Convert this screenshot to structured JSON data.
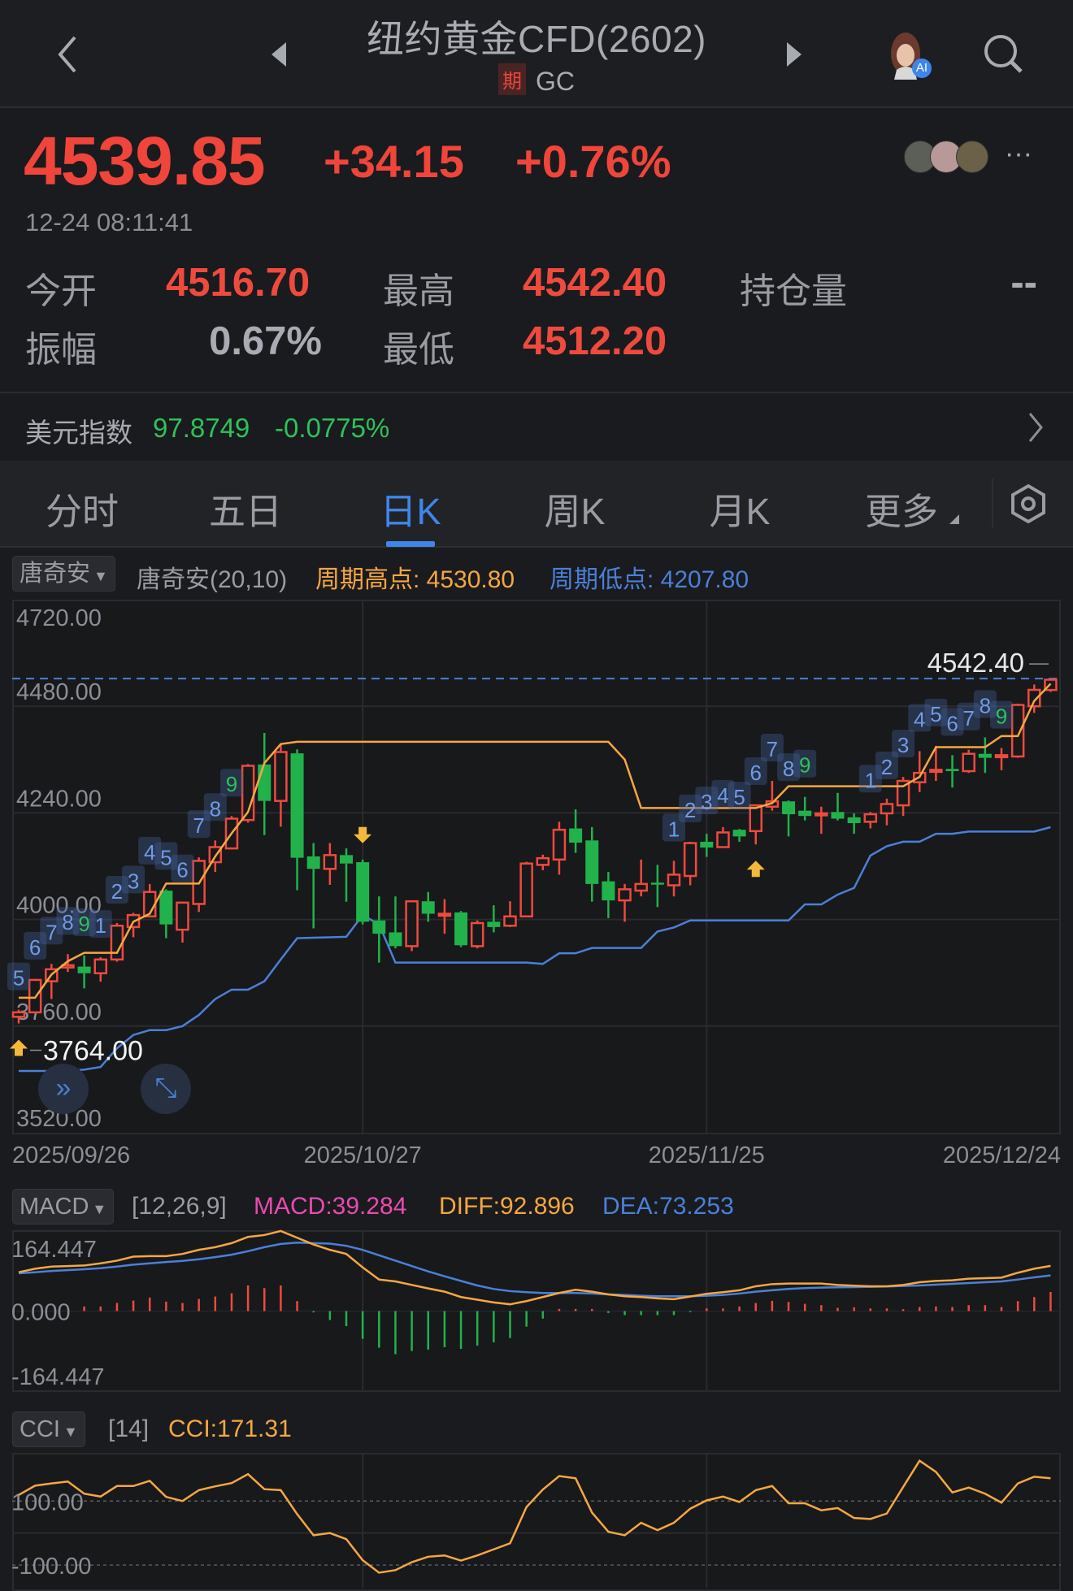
{
  "header": {
    "title": "纽约黄金CFD(2602)",
    "badge": "期",
    "code": "GC",
    "ai_badge": "AI",
    "icons": [
      "back-chevron-icon",
      "prev-triangle-icon",
      "next-triangle-icon",
      "ai-avatar-icon",
      "search-icon"
    ]
  },
  "quote": {
    "price": "4539.85",
    "change": "+34.15",
    "change_pct": "+0.76%",
    "timestamp": "12-24 08:11:41",
    "more": "···",
    "stats": {
      "open_label": "今开",
      "open": "4516.70",
      "high_label": "最高",
      "high": "4542.40",
      "oi_label": "持仓量",
      "oi": "--",
      "amp_label": "振幅",
      "amp": "0.67%",
      "low_label": "最低",
      "low": "4512.20"
    }
  },
  "usd_index": {
    "label": "美元指数",
    "value": "97.8749",
    "change": "-0.0775%"
  },
  "tabs": [
    {
      "label": "分时"
    },
    {
      "label": "五日"
    },
    {
      "label": "日K",
      "active": true
    },
    {
      "label": "周K"
    },
    {
      "label": "月K"
    },
    {
      "label": "更多"
    }
  ],
  "main_indicator": {
    "selector": "唐奇安",
    "params": "唐奇安(20,10)",
    "upper_text": "周期高点: 4530.80",
    "lower_text": "周期低点: 4207.80"
  },
  "macd_indicator": {
    "selector": "MACD",
    "params": "[12,26,9]",
    "macd": "MACD:39.284",
    "diff": "DIFF:92.896",
    "dea": "DEA:73.253"
  },
  "cci_indicator": {
    "selector": "CCI",
    "params": "[14]",
    "cci": "CCI:171.31"
  },
  "colors": {
    "up": "#ef4a3e",
    "down": "#22b24c",
    "upper": "#f5a742",
    "lower": "#4a80d8",
    "accent": "#3f86ea",
    "macd": "#e84bb0"
  },
  "chart_data": [
    {
      "type": "candlestick",
      "title": "日K",
      "ylim": [
        3520,
        4720
      ],
      "yticks": [
        "4720.00",
        "4480.00",
        "4240.00",
        "4000.00",
        "3760.00",
        "3520.00"
      ],
      "ytick_values": [
        4720,
        4480,
        4240,
        4000,
        3760,
        3520
      ],
      "x_labels": [
        {
          "label": "2025/09/26",
          "index": 0
        },
        {
          "label": "2025/10/27",
          "index": 21
        },
        {
          "label": "2025/11/25",
          "index": 42
        },
        {
          "label": "2025/12/24",
          "index": 63
        }
      ],
      "ohlc": [
        [
          3781,
          3797,
          3766,
          3791
        ],
        [
          3791,
          3866,
          3788,
          3864
        ],
        [
          3861,
          3900,
          3821,
          3888
        ],
        [
          3892,
          3922,
          3882,
          3897
        ],
        [
          3894,
          3919,
          3845,
          3879
        ],
        [
          3879,
          3915,
          3860,
          3910
        ],
        [
          3910,
          3992,
          3905,
          3986
        ],
        [
          3983,
          4015,
          3960,
          4010
        ],
        [
          4007,
          4080,
          4007,
          4062
        ],
        [
          4065,
          4068,
          3958,
          3989
        ],
        [
          3977,
          4040,
          3948,
          4038
        ],
        [
          4035,
          4140,
          4017,
          4132
        ],
        [
          4129,
          4178,
          4107,
          4163
        ],
        [
          4160,
          4233,
          4160,
          4227
        ],
        [
          4224,
          4350,
          4218,
          4346
        ],
        [
          4349,
          4420,
          4190,
          4267
        ],
        [
          4267,
          4395,
          4209,
          4377
        ],
        [
          4374,
          4383,
          4066,
          4139
        ],
        [
          4142,
          4172,
          3980,
          4114
        ],
        [
          4114,
          4172,
          4078,
          4145
        ],
        [
          4145,
          4160,
          4040,
          4126
        ],
        [
          4129,
          4135,
          3989,
          3995
        ],
        [
          3998,
          4052,
          3903,
          3968
        ],
        [
          3971,
          4052,
          3935,
          3940
        ],
        [
          3940,
          4043,
          3929,
          4041
        ],
        [
          4041,
          4062,
          3995,
          4013
        ],
        [
          4010,
          4046,
          3968,
          4013
        ],
        [
          4016,
          4019,
          3938,
          3942
        ],
        [
          3940,
          3998,
          3935,
          3992
        ],
        [
          3995,
          4032,
          3971,
          3983
        ],
        [
          3986,
          4041,
          3983,
          4007
        ],
        [
          4007,
          4130,
          4005,
          4126
        ],
        [
          4123,
          4146,
          4111,
          4138
        ],
        [
          4135,
          4220,
          4101,
          4202
        ],
        [
          4205,
          4248,
          4150,
          4173
        ],
        [
          4178,
          4208,
          4040,
          4080
        ],
        [
          4086,
          4107,
          4003,
          4043
        ],
        [
          4043,
          4080,
          3995,
          4068
        ],
        [
          4065,
          4135,
          4052,
          4080
        ],
        [
          4083,
          4123,
          4028,
          4080
        ],
        [
          4077,
          4132,
          4052,
          4101
        ],
        [
          4098,
          4175,
          4077,
          4172
        ],
        [
          4175,
          4193,
          4141,
          4162
        ],
        [
          4163,
          4208,
          4163,
          4196
        ],
        [
          4202,
          4204,
          4175,
          4187
        ],
        [
          4199,
          4259,
          4169,
          4257
        ],
        [
          4254,
          4312,
          4245,
          4266
        ],
        [
          4266,
          4268,
          4187,
          4237
        ],
        [
          4245,
          4276,
          4223,
          4233
        ],
        [
          4236,
          4254,
          4193,
          4239
        ],
        [
          4242,
          4285,
          4223,
          4227
        ],
        [
          4230,
          4239,
          4193,
          4217
        ],
        [
          4220,
          4242,
          4205,
          4237
        ],
        [
          4239,
          4272,
          4212,
          4260
        ],
        [
          4257,
          4321,
          4233,
          4312
        ],
        [
          4309,
          4379,
          4287,
          4330
        ],
        [
          4334,
          4391,
          4312,
          4337
        ],
        [
          4339,
          4370,
          4297,
          4334
        ],
        [
          4334,
          4382,
          4330,
          4373
        ],
        [
          4373,
          4410,
          4330,
          4364
        ],
        [
          4368,
          4386,
          4336,
          4370
        ],
        [
          4367,
          4486,
          4364,
          4483
        ],
        [
          4480,
          4529,
          4465,
          4517
        ],
        [
          4516.7,
          4542.4,
          4512.2,
          4539.85
        ]
      ],
      "upper_band": [
        3824,
        3824,
        3876,
        3906,
        3925,
        3925,
        3925,
        3995,
        4013,
        4081,
        4081,
        4081,
        4142,
        4194,
        4242,
        4352,
        4395,
        4400,
        4400,
        4400,
        4400,
        4400,
        4400,
        4400,
        4400,
        4400,
        4400,
        4400,
        4400,
        4400,
        4400,
        4400,
        4400,
        4400,
        4400,
        4400,
        4400,
        4360,
        4251,
        4251,
        4251,
        4251,
        4251,
        4251,
        4251,
        4251,
        4262,
        4300,
        4300,
        4300,
        4300,
        4300,
        4300,
        4300,
        4300,
        4321,
        4388,
        4388,
        4388,
        4388,
        4413,
        4413,
        4492,
        4530.8
      ],
      "lower_band": [
        3659,
        3659,
        3659,
        3659,
        3662,
        3668,
        3710,
        3740,
        3751,
        3751,
        3760,
        3785,
        3821,
        3842,
        3842,
        3861,
        3910,
        3958,
        3959,
        3960,
        3961,
        4010,
        3989,
        3903,
        3903,
        3903,
        3903,
        3903,
        3903,
        3903,
        3903,
        3903,
        3900,
        3924,
        3924,
        3936,
        3936,
        3936,
        3936,
        3973,
        3982,
        3998,
        3998,
        3998,
        3998,
        3998,
        3998,
        3998,
        4034,
        4034,
        4056,
        4071,
        4144,
        4165,
        4175,
        4175,
        4193,
        4193,
        4198,
        4198,
        4198,
        4198,
        4198,
        4207.8
      ],
      "td_labels": [
        {
          "index": 0,
          "text": "5"
        },
        {
          "index": 1,
          "text": "6"
        },
        {
          "index": 2,
          "text": "7"
        },
        {
          "index": 3,
          "text": "8"
        },
        {
          "index": 4,
          "text": "9",
          "green": true
        },
        {
          "index": 5,
          "text": "1"
        },
        {
          "index": 6,
          "text": "2"
        },
        {
          "index": 7,
          "text": "3"
        },
        {
          "index": 8,
          "text": "4"
        },
        {
          "index": 9,
          "text": "5"
        },
        {
          "index": 10,
          "text": "6"
        },
        {
          "index": 11,
          "text": "7"
        },
        {
          "index": 12,
          "text": "8"
        },
        {
          "index": 13,
          "text": "9",
          "green": true
        },
        {
          "index": 40,
          "text": "1"
        },
        {
          "index": 41,
          "text": "2"
        },
        {
          "index": 42,
          "text": "3"
        },
        {
          "index": 43,
          "text": "4"
        },
        {
          "index": 44,
          "text": "5"
        },
        {
          "index": 45,
          "text": "6"
        },
        {
          "index": 46,
          "text": "7"
        },
        {
          "index": 47,
          "text": "8"
        },
        {
          "index": 48,
          "text": "9",
          "green": true
        },
        {
          "index": 52,
          "text": "1"
        },
        {
          "index": 53,
          "text": "2"
        },
        {
          "index": 54,
          "text": "3"
        },
        {
          "index": 55,
          "text": "4"
        },
        {
          "index": 56,
          "text": "5"
        },
        {
          "index": 57,
          "text": "6"
        },
        {
          "index": 58,
          "text": "7"
        },
        {
          "index": 59,
          "text": "8"
        },
        {
          "index": 60,
          "text": "9",
          "green": true
        }
      ],
      "signals": [
        {
          "index": 0,
          "type": "buy",
          "label": "3764.00"
        },
        {
          "index": 21,
          "type": "sell"
        },
        {
          "index": 45,
          "type": "buy"
        }
      ],
      "max_line": {
        "value": 4542.4,
        "label": "4542.40"
      }
    },
    {
      "type": "macd",
      "ylim": [
        -164.447,
        164.447
      ],
      "yticks": [
        "164.447",
        "0.000",
        "-164.447"
      ],
      "diff": [
        79.8,
        87.0,
        91.4,
        92.5,
        93.6,
        98.1,
        103.6,
        111.9,
        113.0,
        113.0,
        117.4,
        125.8,
        131.3,
        139.6,
        152.4,
        156.2,
        164.5,
        150.7,
        136.8,
        125.8,
        117.4,
        89.7,
        64.8,
        60.9,
        53.7,
        46.5,
        39.9,
        28.8,
        23.3,
        17.7,
        13.9,
        20.5,
        28.8,
        37.1,
        43.8,
        39.9,
        34.3,
        30.5,
        28.8,
        26.0,
        24.4,
        29.9,
        35.5,
        38.8,
        42.7,
        51.0,
        55.4,
        56.5,
        56.5,
        56.5,
        53.7,
        52.1,
        51.0,
        51.0,
        53.7,
        59.3,
        62.0,
        63.2,
        66.5,
        67.6,
        68.7,
        78.7,
        87.0,
        92.896
      ],
      "dea": [
        77.6,
        79.8,
        82.5,
        84.2,
        85.9,
        88.1,
        91.4,
        95.3,
        98.1,
        100.8,
        103.0,
        106.4,
        110.8,
        115.8,
        123.0,
        131.3,
        137.9,
        140.7,
        139.6,
        138.5,
        134.1,
        125.8,
        114.7,
        103.6,
        92.5,
        81.4,
        71.5,
        62.0,
        52.6,
        45.4,
        41.0,
        38.8,
        37.1,
        37.1,
        37.1,
        36.0,
        34.3,
        33.2,
        31.6,
        30.5,
        30.5,
        30.5,
        31.6,
        33.2,
        36.0,
        39.9,
        42.7,
        45.4,
        47.1,
        48.2,
        48.8,
        49.3,
        49.9,
        50.4,
        51.5,
        52.6,
        54.3,
        56.0,
        57.6,
        59.3,
        60.9,
        64.8,
        69.3,
        73.253
      ],
      "macd": [
        0,
        0,
        0,
        0,
        9.4,
        9.4,
        16.6,
        21.6,
        27.7,
        19.4,
        16.6,
        24.9,
        29.9,
        36.6,
        52.6,
        47.1,
        52.6,
        20.5,
        -2.8,
        -18.3,
        -31.0,
        -57.1,
        -75.3,
        -88.6,
        -82.0,
        -79.2,
        -74.2,
        -77.6,
        -70.9,
        -64.3,
        -55.4,
        -32.1,
        -15.5,
        4.4,
        4.4,
        4.4,
        -3.9,
        -8.3,
        -8.3,
        -8.3,
        -8.3,
        -2.2,
        5.5,
        5.5,
        9.4,
        16.6,
        21.0,
        18.8,
        14.9,
        12.2,
        6.6,
        7.8,
        5.5,
        5.5,
        3.9,
        8.3,
        9.4,
        8.3,
        12.2,
        12.2,
        8.3,
        20.5,
        28.8,
        39.284
      ]
    },
    {
      "type": "line",
      "name": "CCI",
      "ylim": [
        -171,
        248
      ],
      "yticks": [
        "100.00",
        "-100.00"
      ],
      "ytick_values": [
        100,
        -100
      ],
      "values": [
        119,
        148,
        155,
        161,
        123,
        114,
        147,
        147,
        163,
        113,
        100,
        134,
        146,
        156,
        184,
        137,
        134,
        59,
        -7,
        0,
        -19,
        -85,
        -124,
        -116,
        -91,
        -74,
        -70,
        -86,
        -70,
        -51,
        -32,
        81,
        136,
        178,
        171,
        64,
        4,
        -7,
        32,
        9,
        32,
        76,
        102,
        114,
        97,
        134,
        147,
        93,
        93,
        71,
        78,
        47,
        44,
        61,
        144,
        226,
        191,
        127,
        142,
        123,
        95,
        155,
        176,
        171.31
      ]
    }
  ]
}
